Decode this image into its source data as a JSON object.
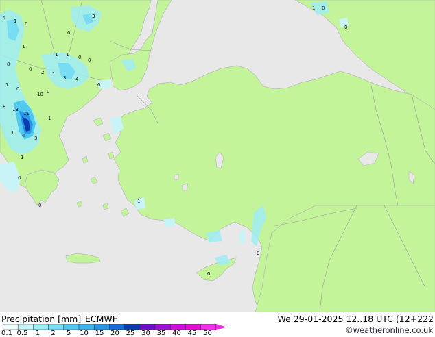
{
  "footer": {
    "title": "Precipitation [mm]",
    "model": "ECMWF",
    "valid": "We 29-01-2025 12..18 UTC (12+222",
    "credit": "©weatheronline.co.uk"
  },
  "scale": {
    "labels": [
      "0.1",
      "0.5",
      "1",
      "2",
      "5",
      "10",
      "15",
      "20",
      "25",
      "30",
      "35",
      "40",
      "45",
      "50"
    ],
    "colors": [
      "#eefcfc",
      "#c8f4f8",
      "#a0ecf6",
      "#78dcf2",
      "#50c8f0",
      "#3cb4ec",
      "#2896e4",
      "#1c6edc",
      "#0c3cb0",
      "#6a10c8",
      "#a010d8",
      "#d010e0",
      "#e410d8",
      "#f030e8"
    ]
  },
  "map_labels": [
    "4",
    "1",
    "0",
    "3",
    "1",
    "0",
    "1",
    "1",
    "0",
    "1",
    "8",
    "0",
    "2",
    "1",
    "3",
    "4",
    "0",
    "1",
    "0",
    "10",
    "0",
    "8",
    "13",
    "11",
    "1",
    "4",
    "3",
    "1",
    "1",
    "0",
    "0",
    "0",
    "0",
    "0",
    "1",
    "0",
    "0"
  ]
}
